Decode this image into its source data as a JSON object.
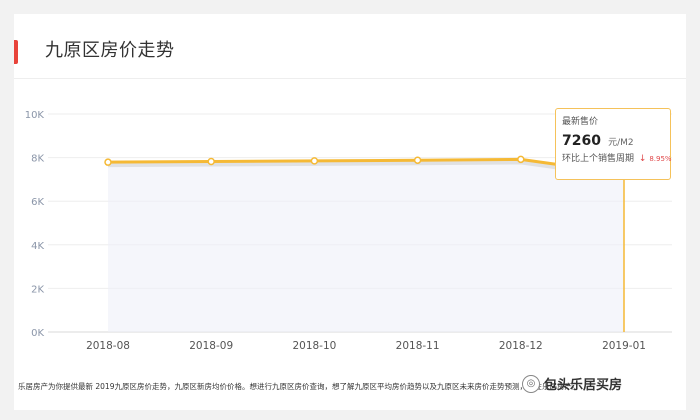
{
  "title": "九原区房价走势",
  "chart_data": {
    "type": "line",
    "x": [
      "2018-08",
      "2018-09",
      "2018-10",
      "2018-11",
      "2018-12",
      "2019-01"
    ],
    "values": [
      7790,
      7820,
      7850,
      7880,
      7920,
      7260
    ],
    "y_ticks": [
      "0K",
      "2K",
      "4K",
      "6K",
      "8K",
      "10K"
    ],
    "ylim": [
      0,
      10000
    ],
    "colors": {
      "line": "#f5b935",
      "point_fill": "#ffffff",
      "area": "#eef0f9"
    },
    "grid": true
  },
  "tooltip": {
    "label": "最新售价",
    "price": "7260",
    "unit": "元/M2",
    "change_label": "环比上个销售周期",
    "change_arrow": "↓",
    "change_value": "8.95%"
  },
  "description": "乐居房产为你提供最新 2019九原区房价走势，九原区新房均价价格。想进行九原区房价查询，想了解九原区平均房价趋势以及九原区未来房价走势预测，尽在乐居房产。",
  "watermark": {
    "icon": "wechat-icon",
    "text": "包头乐居买房"
  }
}
